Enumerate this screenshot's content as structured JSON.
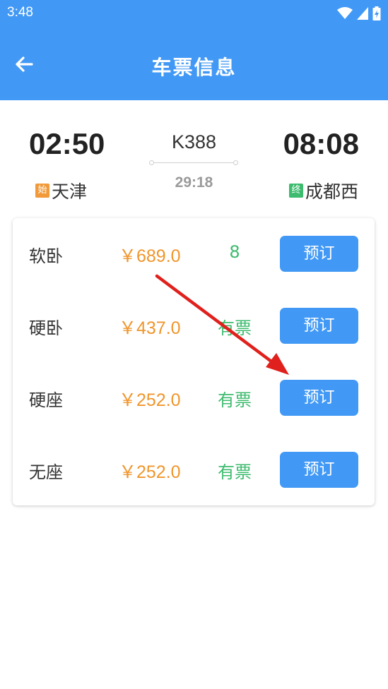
{
  "status_bar": {
    "time": "3:48"
  },
  "header": {
    "title": "车票信息",
    "back_icon": "arrow-left-icon"
  },
  "journey": {
    "departure_time": "02:50",
    "arrival_time": "08:08",
    "train_number": "K388",
    "duration": "29:18",
    "departure_badge": "始",
    "departure_station": "天津",
    "arrival_badge": "终",
    "arrival_station": "成都西"
  },
  "seats": [
    {
      "name": "软卧",
      "price": "￥689.0",
      "availability": "8",
      "button": "预订"
    },
    {
      "name": "硬卧",
      "price": "￥437.0",
      "availability": "有票",
      "button": "预订"
    },
    {
      "name": "硬座",
      "price": "￥252.0",
      "availability": "有票",
      "button": "预订"
    },
    {
      "name": "无座",
      "price": "￥252.0",
      "availability": "有票",
      "button": "预订"
    }
  ],
  "colors": {
    "primary": "#4299f5",
    "price": "#f0962c",
    "available": "#3dbb6e",
    "start_badge": "#f19a3a",
    "end_badge": "#3dbb6e",
    "annotation_arrow": "#e0201c"
  }
}
